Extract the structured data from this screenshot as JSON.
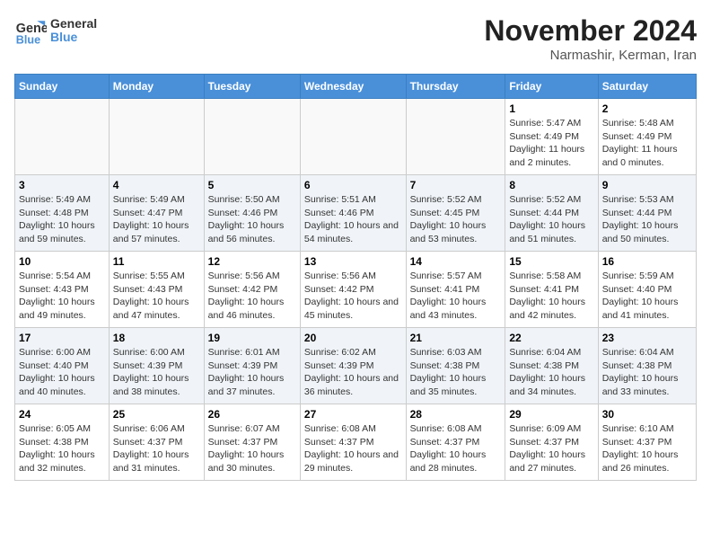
{
  "header": {
    "logo_line1": "General",
    "logo_line2": "Blue",
    "title": "November 2024",
    "subtitle": "Narmashir, Kerman, Iran"
  },
  "weekdays": [
    "Sunday",
    "Monday",
    "Tuesday",
    "Wednesday",
    "Thursday",
    "Friday",
    "Saturday"
  ],
  "weeks": [
    [
      {
        "day": "",
        "info": ""
      },
      {
        "day": "",
        "info": ""
      },
      {
        "day": "",
        "info": ""
      },
      {
        "day": "",
        "info": ""
      },
      {
        "day": "",
        "info": ""
      },
      {
        "day": "1",
        "info": "Sunrise: 5:47 AM\nSunset: 4:49 PM\nDaylight: 11 hours and 2 minutes."
      },
      {
        "day": "2",
        "info": "Sunrise: 5:48 AM\nSunset: 4:49 PM\nDaylight: 11 hours and 0 minutes."
      }
    ],
    [
      {
        "day": "3",
        "info": "Sunrise: 5:49 AM\nSunset: 4:48 PM\nDaylight: 10 hours and 59 minutes."
      },
      {
        "day": "4",
        "info": "Sunrise: 5:49 AM\nSunset: 4:47 PM\nDaylight: 10 hours and 57 minutes."
      },
      {
        "day": "5",
        "info": "Sunrise: 5:50 AM\nSunset: 4:46 PM\nDaylight: 10 hours and 56 minutes."
      },
      {
        "day": "6",
        "info": "Sunrise: 5:51 AM\nSunset: 4:46 PM\nDaylight: 10 hours and 54 minutes."
      },
      {
        "day": "7",
        "info": "Sunrise: 5:52 AM\nSunset: 4:45 PM\nDaylight: 10 hours and 53 minutes."
      },
      {
        "day": "8",
        "info": "Sunrise: 5:52 AM\nSunset: 4:44 PM\nDaylight: 10 hours and 51 minutes."
      },
      {
        "day": "9",
        "info": "Sunrise: 5:53 AM\nSunset: 4:44 PM\nDaylight: 10 hours and 50 minutes."
      }
    ],
    [
      {
        "day": "10",
        "info": "Sunrise: 5:54 AM\nSunset: 4:43 PM\nDaylight: 10 hours and 49 minutes."
      },
      {
        "day": "11",
        "info": "Sunrise: 5:55 AM\nSunset: 4:43 PM\nDaylight: 10 hours and 47 minutes."
      },
      {
        "day": "12",
        "info": "Sunrise: 5:56 AM\nSunset: 4:42 PM\nDaylight: 10 hours and 46 minutes."
      },
      {
        "day": "13",
        "info": "Sunrise: 5:56 AM\nSunset: 4:42 PM\nDaylight: 10 hours and 45 minutes."
      },
      {
        "day": "14",
        "info": "Sunrise: 5:57 AM\nSunset: 4:41 PM\nDaylight: 10 hours and 43 minutes."
      },
      {
        "day": "15",
        "info": "Sunrise: 5:58 AM\nSunset: 4:41 PM\nDaylight: 10 hours and 42 minutes."
      },
      {
        "day": "16",
        "info": "Sunrise: 5:59 AM\nSunset: 4:40 PM\nDaylight: 10 hours and 41 minutes."
      }
    ],
    [
      {
        "day": "17",
        "info": "Sunrise: 6:00 AM\nSunset: 4:40 PM\nDaylight: 10 hours and 40 minutes."
      },
      {
        "day": "18",
        "info": "Sunrise: 6:00 AM\nSunset: 4:39 PM\nDaylight: 10 hours and 38 minutes."
      },
      {
        "day": "19",
        "info": "Sunrise: 6:01 AM\nSunset: 4:39 PM\nDaylight: 10 hours and 37 minutes."
      },
      {
        "day": "20",
        "info": "Sunrise: 6:02 AM\nSunset: 4:39 PM\nDaylight: 10 hours and 36 minutes."
      },
      {
        "day": "21",
        "info": "Sunrise: 6:03 AM\nSunset: 4:38 PM\nDaylight: 10 hours and 35 minutes."
      },
      {
        "day": "22",
        "info": "Sunrise: 6:04 AM\nSunset: 4:38 PM\nDaylight: 10 hours and 34 minutes."
      },
      {
        "day": "23",
        "info": "Sunrise: 6:04 AM\nSunset: 4:38 PM\nDaylight: 10 hours and 33 minutes."
      }
    ],
    [
      {
        "day": "24",
        "info": "Sunrise: 6:05 AM\nSunset: 4:38 PM\nDaylight: 10 hours and 32 minutes."
      },
      {
        "day": "25",
        "info": "Sunrise: 6:06 AM\nSunset: 4:37 PM\nDaylight: 10 hours and 31 minutes."
      },
      {
        "day": "26",
        "info": "Sunrise: 6:07 AM\nSunset: 4:37 PM\nDaylight: 10 hours and 30 minutes."
      },
      {
        "day": "27",
        "info": "Sunrise: 6:08 AM\nSunset: 4:37 PM\nDaylight: 10 hours and 29 minutes."
      },
      {
        "day": "28",
        "info": "Sunrise: 6:08 AM\nSunset: 4:37 PM\nDaylight: 10 hours and 28 minutes."
      },
      {
        "day": "29",
        "info": "Sunrise: 6:09 AM\nSunset: 4:37 PM\nDaylight: 10 hours and 27 minutes."
      },
      {
        "day": "30",
        "info": "Sunrise: 6:10 AM\nSunset: 4:37 PM\nDaylight: 10 hours and 26 minutes."
      }
    ]
  ]
}
